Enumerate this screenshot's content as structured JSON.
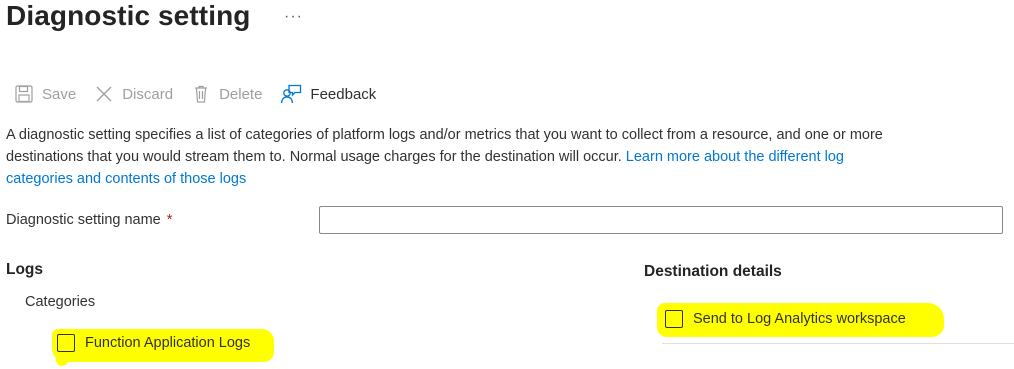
{
  "page": {
    "title": "Diagnostic setting",
    "more": "···"
  },
  "toolbar": {
    "save": "Save",
    "discard": "Discard",
    "delete": "Delete",
    "feedback": "Feedback"
  },
  "description": {
    "text": "A diagnostic setting specifies a list of categories of platform logs and/or metrics that you want to collect from a resource, and one or more destinations that you would stream them to. Normal usage charges for the destination will occur. ",
    "link": "Learn more about the different log categories and contents of those logs"
  },
  "name_field": {
    "label": "Diagnostic setting name",
    "required_mark": "*",
    "value": ""
  },
  "logs": {
    "heading": "Logs",
    "categories_label": "Categories",
    "items": [
      {
        "label": "Function Application Logs",
        "checked": false
      }
    ]
  },
  "destination": {
    "heading": "Destination details",
    "items": [
      {
        "label": "Send to Log Analytics workspace",
        "checked": false
      }
    ]
  },
  "colors": {
    "highlight": "#ffff00",
    "link": "#0078d4",
    "disabled": "#a19f9d"
  }
}
